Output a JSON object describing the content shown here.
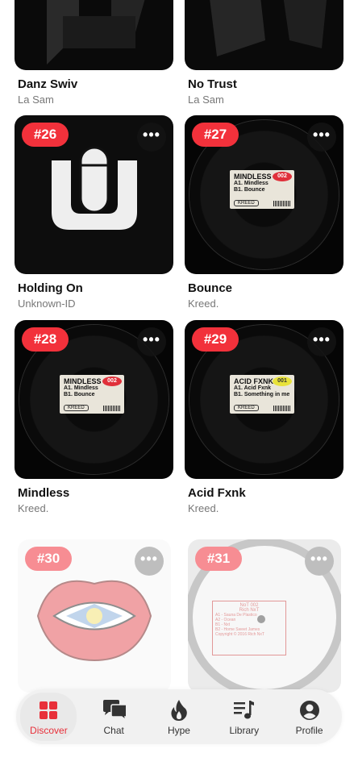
{
  "cards": [
    {
      "title": "Danz Swiv",
      "artist": "La Sam"
    },
    {
      "title": "No Trust",
      "artist": "La Sam"
    },
    {
      "rank": "#26",
      "title": "Holding On",
      "artist": "Unknown-ID"
    },
    {
      "rank": "#27",
      "title": "Bounce",
      "artist": "Kreed.",
      "label": {
        "name": "MINDLESS",
        "tag": "002",
        "a": "A1. Mindless",
        "b": "B1. Bounce",
        "code": "KREED"
      }
    },
    {
      "rank": "#28",
      "title": "Mindless",
      "artist": "Kreed.",
      "label": {
        "name": "MINDLESS",
        "tag": "002",
        "a": "A1. Mindless",
        "b": "B1. Bounce",
        "code": "KREED"
      }
    },
    {
      "rank": "#29",
      "title": "Acid Fxnk",
      "artist": "Kreed.",
      "label": {
        "name": "ACID FXNK",
        "tag": "001",
        "a": "A1. Acid Fxnk",
        "b": "B1. Something in me",
        "code": "KREED"
      }
    },
    {
      "rank": "#30"
    },
    {
      "rank": "#31",
      "label": {
        "name": "NoT 002",
        "l1": "Rich NxT",
        "l2": "A1 - Sauna De Plastico",
        "l3": "A2 - Ocean",
        "l4": "B1 - Nxt",
        "l5": "B2 - Home Sweet James",
        "l6": "Copyright © 2016 Rich NxT"
      }
    }
  ],
  "more_label": "•••",
  "nav": [
    {
      "label": "Discover",
      "icon": "grid-icon"
    },
    {
      "label": "Chat",
      "icon": "chat-bubbles-icon"
    },
    {
      "label": "Hype",
      "icon": "flame-icon"
    },
    {
      "label": "Library",
      "icon": "music-list-icon"
    },
    {
      "label": "Profile",
      "icon": "person-circle-icon"
    }
  ],
  "colors": {
    "accent": "#f2313b",
    "nav_active": "#e8303a"
  }
}
